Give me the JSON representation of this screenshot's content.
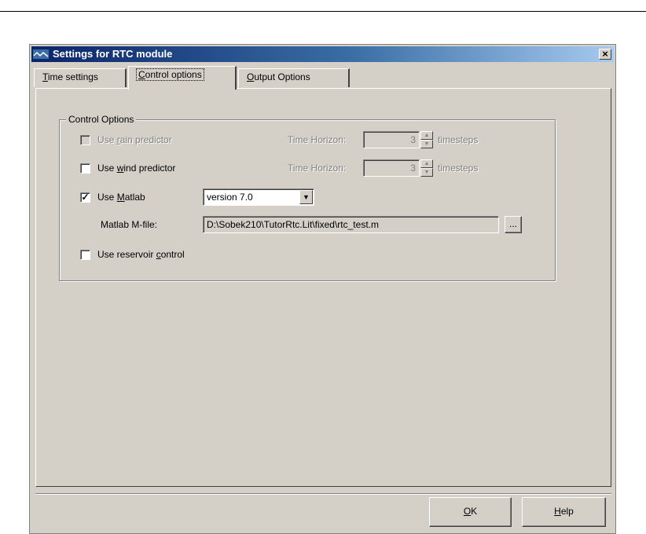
{
  "window": {
    "title": "Settings for RTC module",
    "close": "×"
  },
  "tabs": [
    {
      "pre": "",
      "u": "T",
      "post": "ime settings"
    },
    {
      "pre": "",
      "u": "C",
      "post": "ontrol options"
    },
    {
      "pre": "",
      "u": "O",
      "post": "utput Options"
    }
  ],
  "group": {
    "legend": "Control Options"
  },
  "rain": {
    "pre": "Use ",
    "u": "r",
    "post": "ain predictor",
    "checked": false,
    "horizon_label": "Time Horizon:",
    "horizon_value": "3",
    "unit": "timesteps"
  },
  "wind": {
    "pre": "Use ",
    "u": "w",
    "post": "ind predictor",
    "checked": false,
    "horizon_label": "Time Horizon:",
    "horizon_value": "3",
    "unit": "timesteps"
  },
  "matlab": {
    "pre": "Use ",
    "u": "M",
    "post": "atlab",
    "checked": true,
    "check_mark": "✓",
    "version": "version 7.0",
    "mfile_label": "Matlab M-file:",
    "mfile_value": "D:\\Sobek210\\TutorRtc.Lit\\fixed\\rtc_test.m",
    "browse": "..."
  },
  "reservoir": {
    "pre": "Use reservoir ",
    "u": "c",
    "post": "ontrol",
    "checked": false
  },
  "buttons": {
    "ok": {
      "pre": "",
      "u": "O",
      "post": "K"
    },
    "help": {
      "pre": "",
      "u": "H",
      "post": "elp"
    }
  },
  "colors": {
    "face": "#d4d0c8",
    "title_start": "#0a246a",
    "title_end": "#a6caf0"
  }
}
